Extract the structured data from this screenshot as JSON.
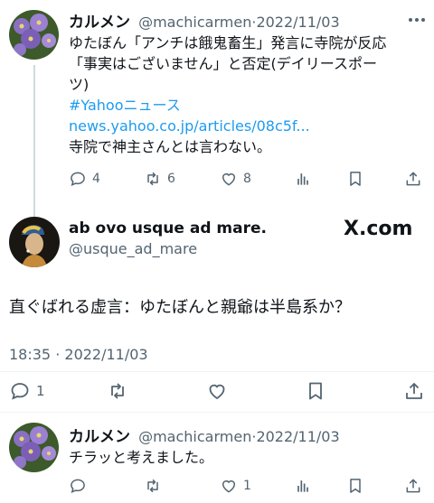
{
  "tweet1": {
    "display_name": "カルメン",
    "handle": "@machicarmen",
    "separator": "·",
    "date": "2022/11/03",
    "lines": [
      "ゆたぼん「アンチは餓鬼畜生」発言に寺院が反応",
      "「事実はございません」と否定(デイリースポー",
      "ツ)"
    ],
    "hashtag": "#Yahooニュース",
    "link": "news.yahoo.co.jp/articles/08c5f...",
    "comment": "寺院で神主さんとは言わない。",
    "replies": "4",
    "retweets": "6",
    "likes": "8"
  },
  "tweet2": {
    "display_name": "ab ovo usque ad mare.",
    "handle": "@usque_ad_mare",
    "watermark": "X.com",
    "text": "直ぐばれる虚言：ゆたぼんと親爺は半島系か？",
    "time": "18:35",
    "separator": "·",
    "date": "2022/11/03",
    "replies": "1"
  },
  "tweet3": {
    "display_name": "カルメン",
    "handle": "@machicarmen",
    "separator": "·",
    "date": "2022/11/03",
    "text": "チラッと考えました。",
    "likes": "1"
  },
  "colors": {
    "text": "#0f1419",
    "secondary": "#536471",
    "link": "#1d9bf0",
    "divider": "#eff3f4"
  }
}
